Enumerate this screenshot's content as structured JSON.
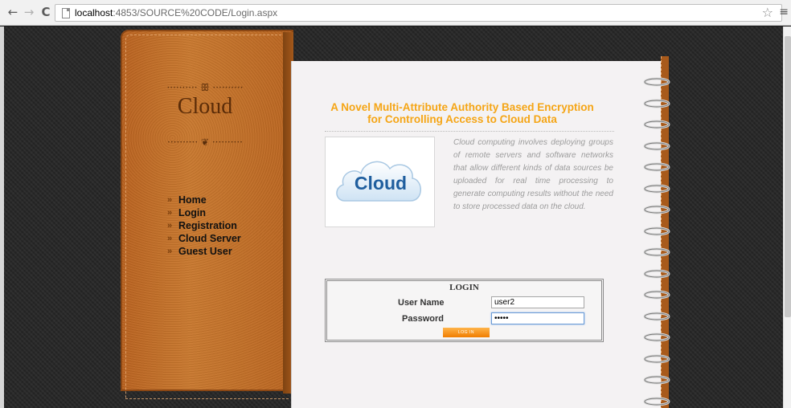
{
  "browser": {
    "url_host": "localhost",
    "url_path": ":4853/SOURCE%20CODE/Login.aspx",
    "back_icon": "←",
    "forward_icon": "→",
    "reload_icon": "C",
    "star_icon": "☆",
    "menu_icon": "≡"
  },
  "sidebar": {
    "ornament_top": "·········· ꕥ ··········",
    "brand": "Cloud",
    "ornament_bottom": "·········· ❦ ··········",
    "menu": [
      "Home",
      "Login",
      "Registration",
      "Cloud Server",
      "Guest User"
    ]
  },
  "main": {
    "headline_line1": "A Novel Multi-Attribute Authority Based Encryption",
    "headline_line2": "for Controlling Access to Cloud Data",
    "logo_text": "Cloud",
    "description": "Cloud computing involves deploying groups of remote servers and software networks that allow different kinds of data sources be uploaded for real time processing to generate computing results without the need to store processed data on the cloud.",
    "login": {
      "title": "LOGIN",
      "username_label": "User Name",
      "username_value": "user2",
      "password_label": "Password",
      "password_value": "•••••",
      "button_label": "LOG IN"
    }
  },
  "colors": {
    "headline": "#f5a515",
    "leather": "#c0712a",
    "button": "#f07d00"
  }
}
